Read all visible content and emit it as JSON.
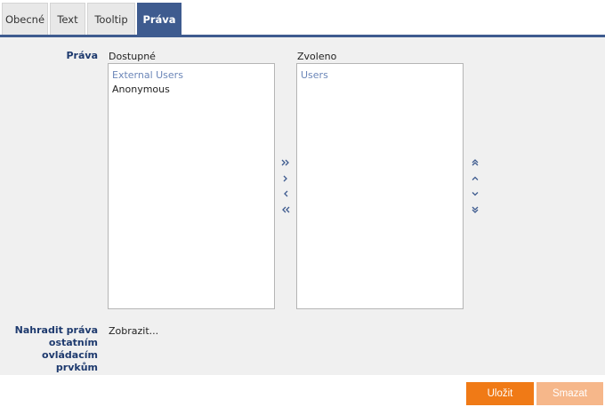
{
  "tabs": [
    {
      "label": "Obecné"
    },
    {
      "label": "Text"
    },
    {
      "label": "Tooltip"
    },
    {
      "label": "Práva"
    }
  ],
  "rights": {
    "label": "Práva",
    "available_label": "Dostupné",
    "selected_label": "Zvoleno",
    "available_items": [
      "External Users",
      "Anonymous"
    ],
    "selected_items": [
      "Users"
    ]
  },
  "replace": {
    "label_lines": [
      "Nahradit práva",
      "ostatním",
      "ovládacím",
      "prvkům"
    ],
    "link": "Zobrazit..."
  },
  "footer": {
    "save": "Uložit",
    "delete": "Smazat"
  },
  "colors": {
    "accent": "#3e5b8f",
    "primary_button": "#f07a16",
    "disabled_button": "#f6b78a"
  }
}
